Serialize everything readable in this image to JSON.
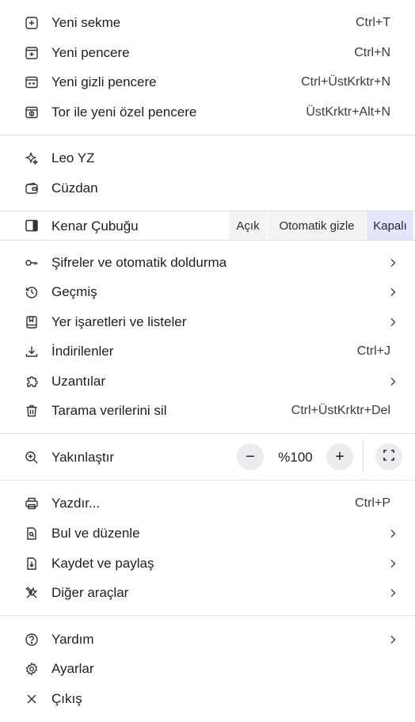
{
  "menu": {
    "group1": [
      {
        "label": "Yeni sekme",
        "shortcut": "Ctrl+T",
        "icon": "new-tab-icon"
      },
      {
        "label": "Yeni pencere",
        "shortcut": "Ctrl+N",
        "icon": "new-window-icon"
      },
      {
        "label": "Yeni gizli pencere",
        "shortcut": "Ctrl+ÜstKrktr+N",
        "icon": "private-window-icon"
      },
      {
        "label": "Tor ile yeni özel pencere",
        "shortcut": "ÜstKrktr+Alt+N",
        "icon": "tor-window-icon"
      }
    ],
    "group2": [
      {
        "label": "Leo YZ",
        "icon": "leo-ai-icon"
      },
      {
        "label": "Cüzdan",
        "icon": "wallet-icon"
      }
    ],
    "sidebar": {
      "label": "Kenar Çubuğu",
      "icon": "sidebar-icon",
      "options": [
        "Açık",
        "Otomatik gizle",
        "Kapalı"
      ],
      "selected": "Kapalı"
    },
    "group3": [
      {
        "label": "Şifreler ve otomatik doldurma",
        "icon": "key-icon",
        "submenu": true
      },
      {
        "label": "Geçmiş",
        "icon": "history-icon",
        "submenu": true
      },
      {
        "label": "Yer işaretleri ve listeler",
        "icon": "bookmark-icon",
        "submenu": true
      },
      {
        "label": "İndirilenler",
        "shortcut": "Ctrl+J",
        "icon": "download-icon"
      },
      {
        "label": "Uzantılar",
        "icon": "extensions-icon",
        "submenu": true
      },
      {
        "label": "Tarama verilerini sil",
        "shortcut": "Ctrl+ÜstKrktr+Del",
        "icon": "trash-icon"
      }
    ],
    "zoom": {
      "label": "Yakınlaştır",
      "icon": "zoom-icon",
      "decrease": "−",
      "value": "%100",
      "increase": "+"
    },
    "group4": [
      {
        "label": "Yazdır...",
        "shortcut": "Ctrl+P",
        "icon": "print-icon"
      },
      {
        "label": "Bul ve düzenle",
        "icon": "find-icon",
        "submenu": true
      },
      {
        "label": "Kaydet ve paylaş",
        "icon": "save-share-icon",
        "submenu": true
      },
      {
        "label": "Diğer araçlar",
        "icon": "tools-icon",
        "submenu": true
      }
    ],
    "group5": [
      {
        "label": "Yardım",
        "icon": "help-icon",
        "submenu": true
      },
      {
        "label": "Ayarlar",
        "icon": "settings-icon"
      },
      {
        "label": "Çıkış",
        "icon": "close-icon"
      }
    ]
  },
  "colors": {
    "selected_segment": "#e5e6fb",
    "segment_bg": "#f3f3f3",
    "divider": "#dedede",
    "text": "#1f1f1f"
  }
}
